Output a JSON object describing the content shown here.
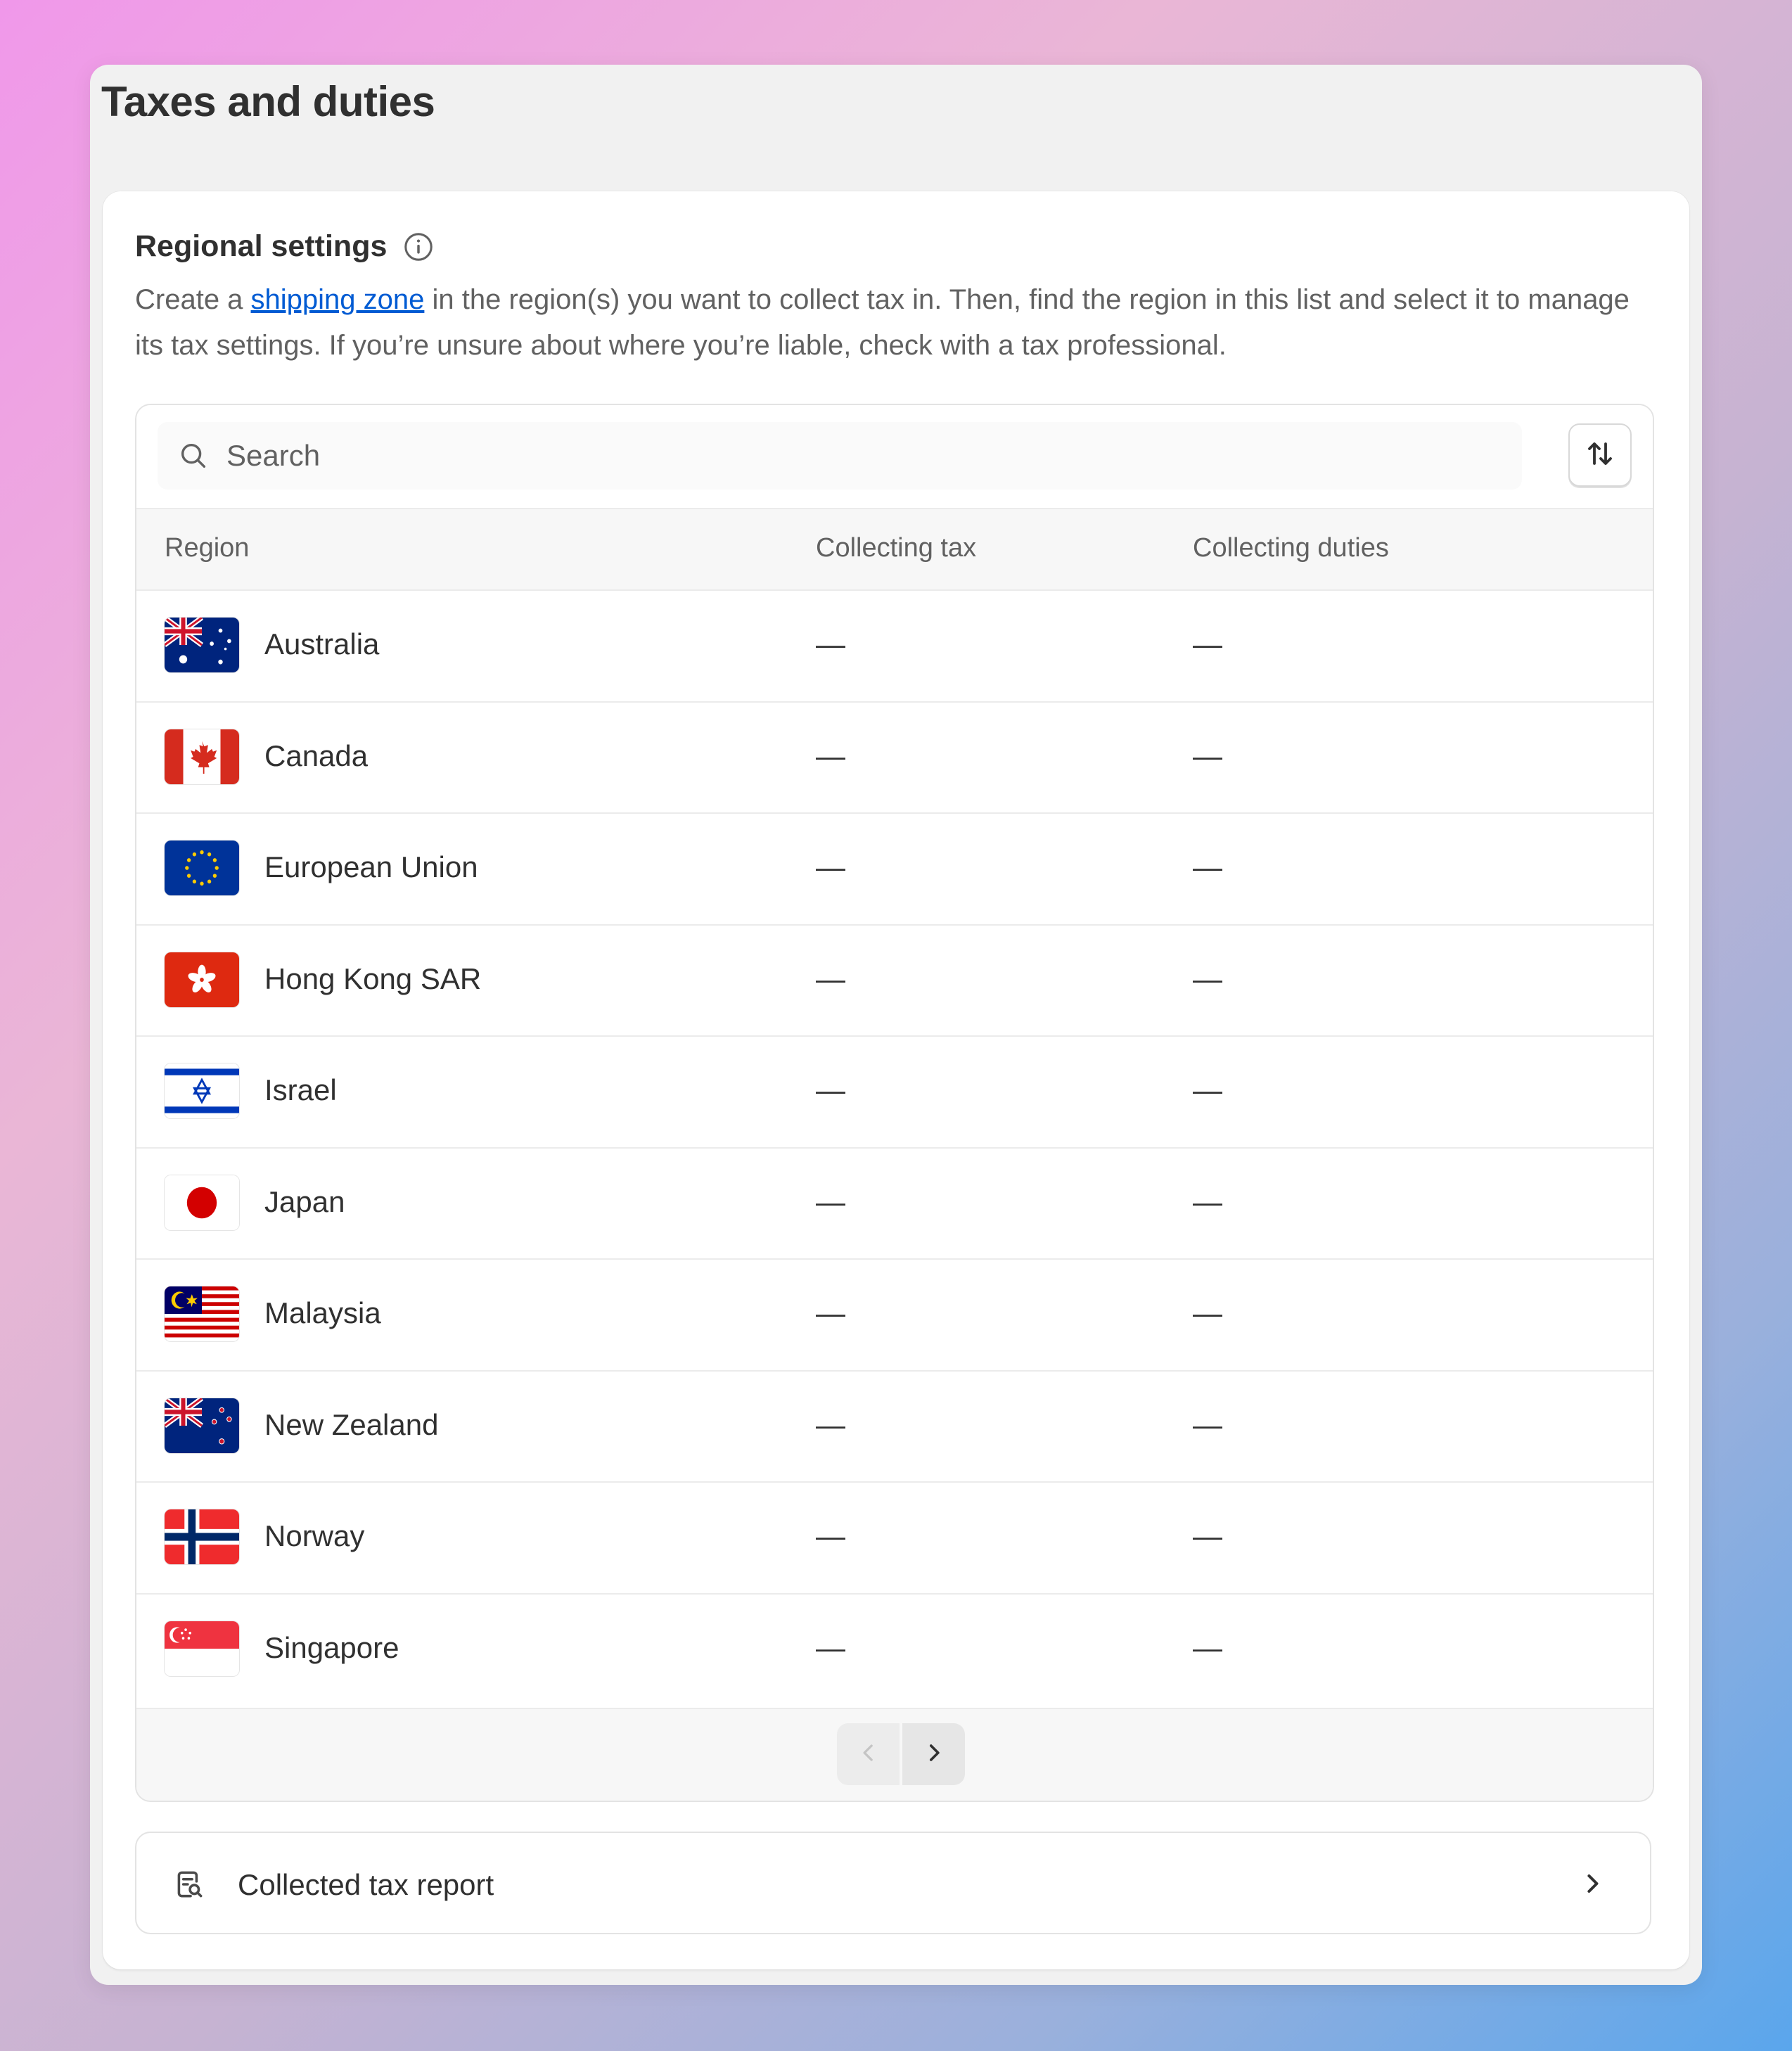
{
  "page": {
    "title": "Taxes and duties"
  },
  "regional_settings": {
    "title": "Regional settings",
    "description_before": "Create a ",
    "link_text": "shipping zone",
    "description_after": " in the region(s) you want to collect tax in. Then, find the region in this list and select it to manage its tax settings. If you’re unsure about where you’re liable, check with a tax professional."
  },
  "search": {
    "placeholder": "Search",
    "value": ""
  },
  "table": {
    "headers": {
      "region": "Region",
      "collecting_tax": "Collecting tax",
      "collecting_duties": "Collecting duties"
    },
    "rows": [
      {
        "flag": "australia-flag-icon",
        "region": "Australia",
        "tax": "—",
        "duties": "—"
      },
      {
        "flag": "canada-flag-icon",
        "region": "Canada",
        "tax": "—",
        "duties": "—"
      },
      {
        "flag": "european-union-flag-icon",
        "region": "European Union",
        "tax": "—",
        "duties": "—"
      },
      {
        "flag": "hong-kong-flag-icon",
        "region": "Hong Kong SAR",
        "tax": "—",
        "duties": "—"
      },
      {
        "flag": "israel-flag-icon",
        "region": "Israel",
        "tax": "—",
        "duties": "—"
      },
      {
        "flag": "japan-flag-icon",
        "region": "Japan",
        "tax": "—",
        "duties": "—"
      },
      {
        "flag": "malaysia-flag-icon",
        "region": "Malaysia",
        "tax": "—",
        "duties": "—"
      },
      {
        "flag": "new-zealand-flag-icon",
        "region": "New Zealand",
        "tax": "—",
        "duties": "—"
      },
      {
        "flag": "norway-flag-icon",
        "region": "Norway",
        "tax": "—",
        "duties": "—"
      },
      {
        "flag": "singapore-flag-icon",
        "region": "Singapore",
        "tax": "—",
        "duties": "—"
      }
    ]
  },
  "pagination": {
    "previous_enabled": false,
    "next_enabled": true
  },
  "report": {
    "label": "Collected tax report"
  },
  "colors": {
    "link": "#005bd3",
    "text": "#303030",
    "muted": "#616161",
    "surface": "#f1f1f1"
  }
}
